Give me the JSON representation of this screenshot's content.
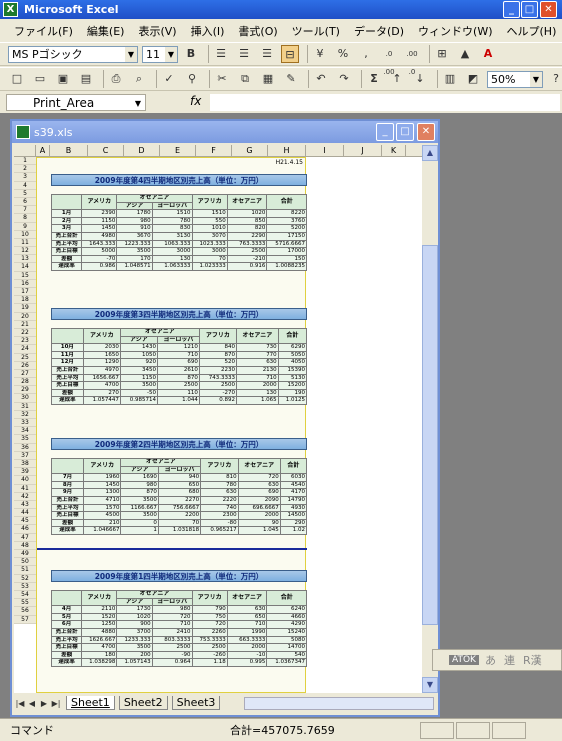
{
  "titlebar": {
    "title": "Microsoft Excel",
    "minimize": "_",
    "maximize": "□",
    "close": "✕"
  },
  "menu": [
    "ファイル(F)",
    "編集(E)",
    "表示(V)",
    "挿入(I)",
    "書式(O)",
    "ツール(T)",
    "データ(D)",
    "ウィンドウ(W)",
    "ヘルプ(H)"
  ],
  "format_toolbar": {
    "font": "MS Pゴシック",
    "size": "11",
    "bold": "B",
    "percent": "%",
    "comma": ",",
    "inc_dec": ".0 .00",
    "dec_dec": ".00 .0"
  },
  "std_toolbar": {
    "zoom": "50%",
    "sum": "Σ"
  },
  "formula_bar": {
    "name_box": "Print_Area",
    "fx": "fx",
    "value": ""
  },
  "document": {
    "title": "s39.xls"
  },
  "columns": [
    "A",
    "B",
    "C",
    "D",
    "E",
    "F",
    "G",
    "H",
    "I",
    "J",
    "K"
  ],
  "rows": [
    "1",
    "2",
    "3",
    "4",
    "5",
    "6",
    "7",
    "8",
    "9",
    "10",
    "11",
    "12",
    "13",
    "14",
    "15",
    "16",
    "17",
    "18",
    "19",
    "20",
    "21",
    "22",
    "23",
    "24",
    "25",
    "26",
    "27",
    "28",
    "29",
    "30",
    "31",
    "32",
    "33",
    "34",
    "35",
    "36",
    "37",
    "38",
    "39",
    "40",
    "41",
    "42",
    "43",
    "44",
    "45",
    "46",
    "47",
    "48",
    "49",
    "50",
    "51",
    "52",
    "53",
    "54",
    "55",
    "56",
    "57"
  ],
  "date_cell": "H21.4.15",
  "col_headers": {
    "america": "アメリカ",
    "oceania": "オセアニア",
    "asia": "アジア",
    "europe": "ヨーロッパ",
    "africa": "アフリカ",
    "oceania2": "オセアニア",
    "total": "合計"
  },
  "panels": [
    {
      "title": "2009年度第4四半期地区別売上高（単位：万円）",
      "rows": [
        {
          "label": "1月",
          "values": [
            "2390",
            "1780",
            "1510",
            "1510",
            "1020",
            "8220"
          ]
        },
        {
          "label": "2月",
          "values": [
            "1150",
            "980",
            "780",
            "550",
            "850",
            "3760"
          ]
        },
        {
          "label": "3月",
          "values": [
            "1450",
            "910",
            "830",
            "1010",
            "820",
            "5200"
          ]
        },
        {
          "label": "売上合計",
          "values": [
            "4980",
            "3670",
            "3130",
            "3070",
            "2290",
            "17150"
          ]
        },
        {
          "label": "売上平均",
          "values": [
            "1643.333",
            "1223.333",
            "1063.333",
            "1023.333",
            "763.3333",
            "5716.6667"
          ]
        },
        {
          "label": "売上目標",
          "values": [
            "5000",
            "3500",
            "3000",
            "3000",
            "2500",
            "17000"
          ]
        },
        {
          "label": "差額",
          "values": [
            "-70",
            "170",
            "130",
            "70",
            "-210",
            "150"
          ]
        },
        {
          "label": "達成率",
          "values": [
            "0.986",
            "1.048571",
            "1.063333",
            "1.023333",
            "0.916",
            "1.0088235"
          ]
        }
      ]
    },
    {
      "title": "2009年度第3四半期地区別売上高（単位：万円）",
      "rows": [
        {
          "label": "10月",
          "values": [
            "2030",
            "1430",
            "1210",
            "840",
            "730",
            "6290"
          ]
        },
        {
          "label": "11月",
          "values": [
            "1650",
            "1050",
            "710",
            "870",
            "770",
            "5050"
          ]
        },
        {
          "label": "12月",
          "values": [
            "1290",
            "920",
            "690",
            "520",
            "630",
            "4050"
          ]
        },
        {
          "label": "売上合計",
          "values": [
            "4970",
            "3450",
            "2610",
            "2230",
            "2130",
            "15390"
          ]
        },
        {
          "label": "売上平均",
          "values": [
            "1656.667",
            "1150",
            "870",
            "743.3333",
            "710",
            "5130"
          ]
        },
        {
          "label": "売上目標",
          "values": [
            "4700",
            "3500",
            "2500",
            "2500",
            "2000",
            "15200"
          ]
        },
        {
          "label": "差額",
          "values": [
            "270",
            "-50",
            "110",
            "-270",
            "130",
            "190"
          ]
        },
        {
          "label": "達成率",
          "values": [
            "1.057447",
            "0.985714",
            "1.044",
            "0.892",
            "1.065",
            "1.0125"
          ]
        }
      ]
    },
    {
      "title": "2009年度第2四半期地区別売上高（単位：万円）",
      "rows": [
        {
          "label": "7月",
          "values": [
            "1960",
            "1690",
            "940",
            "810",
            "720",
            "6030"
          ]
        },
        {
          "label": "8月",
          "values": [
            "1450",
            "980",
            "650",
            "780",
            "630",
            "4540"
          ]
        },
        {
          "label": "9月",
          "values": [
            "1300",
            "870",
            "680",
            "630",
            "690",
            "4170"
          ]
        },
        {
          "label": "売上合計",
          "values": [
            "4710",
            "3500",
            "2270",
            "2220",
            "2090",
            "14790"
          ]
        },
        {
          "label": "売上平均",
          "values": [
            "1570",
            "1166.667",
            "756.6667",
            "740",
            "696.6667",
            "4930"
          ]
        },
        {
          "label": "売上目標",
          "values": [
            "4500",
            "3500",
            "2200",
            "2300",
            "2000",
            "14500"
          ]
        },
        {
          "label": "差額",
          "values": [
            "210",
            "0",
            "70",
            "-80",
            "90",
            "290"
          ]
        },
        {
          "label": "達成率",
          "values": [
            "1.046667",
            "1",
            "1.031818",
            "0.965217",
            "1.045",
            "1.02"
          ]
        }
      ]
    },
    {
      "title": "2009年度第1四半期地区別売上高（単位：万円）",
      "rows": [
        {
          "label": "4月",
          "values": [
            "2110",
            "1730",
            "980",
            "790",
            "630",
            "6240"
          ]
        },
        {
          "label": "5月",
          "values": [
            "1520",
            "1020",
            "720",
            "750",
            "650",
            "4660"
          ]
        },
        {
          "label": "6月",
          "values": [
            "1250",
            "900",
            "710",
            "720",
            "710",
            "4290"
          ]
        },
        {
          "label": "売上合計",
          "values": [
            "4880",
            "3700",
            "2410",
            "2260",
            "1990",
            "15240"
          ]
        },
        {
          "label": "売上平均",
          "values": [
            "1626.667",
            "1233.333",
            "803.3333",
            "753.3333",
            "663.3333",
            "5080"
          ]
        },
        {
          "label": "売上目標",
          "values": [
            "4700",
            "3500",
            "2500",
            "2500",
            "2000",
            "14700"
          ]
        },
        {
          "label": "差額",
          "values": [
            "180",
            "200",
            "-90",
            "-260",
            "-10",
            "540"
          ]
        },
        {
          "label": "達成率",
          "values": [
            "1.038298",
            "1.057143",
            "0.964",
            "1.18",
            "0.995",
            "1.0367347"
          ]
        }
      ]
    }
  ],
  "sheet_tabs": [
    "Sheet1",
    "Sheet2",
    "Sheet3"
  ],
  "ime": {
    "name": "ATOK",
    "a": "あ",
    "ren": "連",
    "r": "R漢"
  },
  "status": {
    "mode": "コマンド",
    "sum": "合計=457075.7659"
  }
}
